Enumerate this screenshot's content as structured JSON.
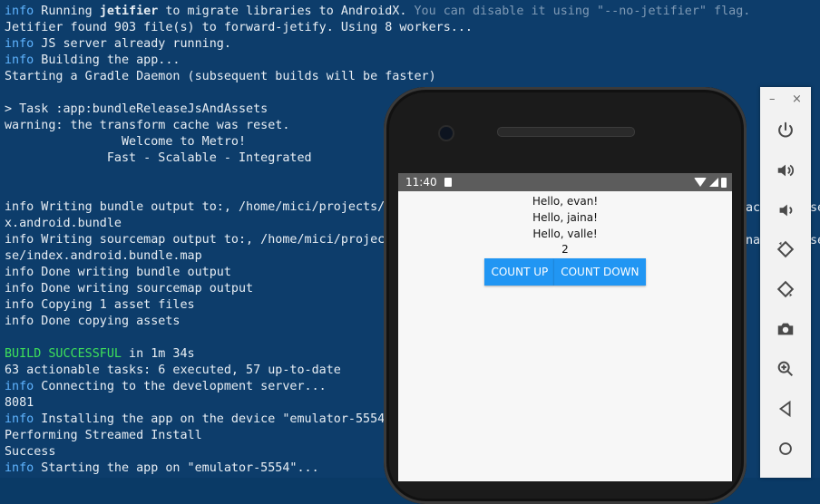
{
  "terminal": {
    "lines": [
      {
        "kw": "info",
        "text": " Running ",
        "bold": "jetifier",
        "rest": " to migrate libraries to AndroidX. ",
        "dim": "You can disable it using \"--no-jetifier\" flag."
      },
      {
        "plain": "Jetifier found 903 file(s) to forward-jetify. Using 8 workers..."
      },
      {
        "kw": "info",
        "text": " JS server already running."
      },
      {
        "kw": "info",
        "text": " Building the app..."
      },
      {
        "plain": "Starting a Gradle Daemon (subsequent builds will be faster)"
      },
      {
        "plain": ""
      },
      {
        "plain": "> Task :app:bundleReleaseJsAndAssets"
      },
      {
        "plain": "warning: the transform cache was reset."
      },
      {
        "plain": "                Welcome to Metro!"
      },
      {
        "plain": "              Fast - Scalable - Integrated"
      },
      {
        "plain": ""
      },
      {
        "plain": ""
      },
      {
        "plain": "info Writing bundle output to:, /home/mici/projects/"
      },
      {
        "plain": "x.android.bundle"
      },
      {
        "plain": "info Writing sourcemap output to:, /home/mici/projec"
      },
      {
        "plain": "se/index.android.bundle.map"
      },
      {
        "plain": "info Done writing bundle output"
      },
      {
        "plain": "info Done writing sourcemap output"
      },
      {
        "plain": "info Copying 1 asset files"
      },
      {
        "plain": "info Done copying assets"
      },
      {
        "plain": ""
      },
      {
        "green": "BUILD SUCCESSFUL",
        "text": " in 1m 34s"
      },
      {
        "plain": "63 actionable tasks: 6 executed, 57 up-to-date"
      },
      {
        "kw": "info",
        "text": " Connecting to the development server..."
      },
      {
        "plain": "8081"
      },
      {
        "kw": "info",
        "text": " Installing the app on the device \"emulator-5554"
      },
      {
        "plain": "Performing Streamed Install"
      },
      {
        "plain": "Success"
      },
      {
        "kw": "info",
        "text": " Starting the app on \"emulator-5554\"..."
      }
    ],
    "right_fragments": [
      "ac",
      "se",
      "na",
      "se"
    ]
  },
  "phone": {
    "status_time": "11:40",
    "greetings": [
      "Hello, evan!",
      "Hello, jaina!",
      "Hello, valle!"
    ],
    "count": "2",
    "count_up_label": "COUNT UP",
    "count_down_label": "COUNT DOWN"
  },
  "toolbar": {
    "minimize_label": "–",
    "close_label": "×",
    "icons": [
      "power-icon",
      "volume-up-icon",
      "volume-down-icon",
      "rotate-left-icon",
      "rotate-right-icon",
      "camera-icon",
      "zoom-icon",
      "back-icon",
      "home-icon"
    ]
  },
  "colors": {
    "terminal_bg": "#0d3d6b",
    "info": "#5fb4ff",
    "success": "#3ee05a",
    "button": "#2196f3"
  }
}
